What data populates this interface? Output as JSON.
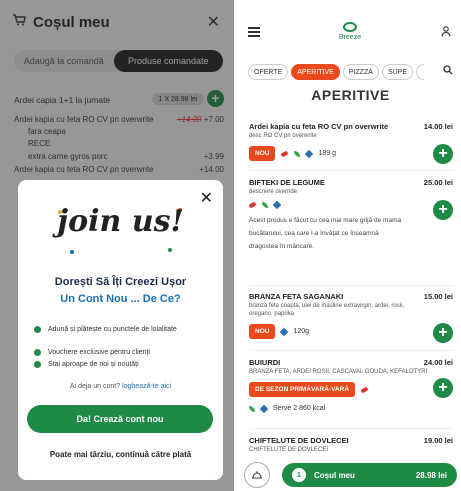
{
  "cart": {
    "title": "Coșul meu",
    "tabs": [
      "Adaugă la comandă",
      "Produse comandate"
    ],
    "active_tab": "Produse comandate",
    "items": [
      {
        "name": "Ardei capia 1+1 la jumate",
        "qty_price": "1 X 28.98 lei"
      },
      {
        "name": "Ardei kapia cu feta RO CV pn overwrite",
        "old_price": "+14.00",
        "price": "+7.00",
        "mods": [
          "fara ceapa",
          "RECE"
        ]
      },
      {
        "name": "extra carne gyros porc",
        "price": "+3.99"
      },
      {
        "name": "Ardei kapia cu feta RO CV pn overwrite",
        "price": "+14.00"
      }
    ]
  },
  "modal": {
    "headline": "join us!",
    "question_line1": "Dorești Să Îți Creezi Ușor",
    "question_line2": "Un Cont Nou ... De Ce?",
    "benefits": [
      "Adună și plătește cu punctele de loialitate",
      "Vouchere exclusive pentru clienți",
      "Stai aproape de noi și noutăți"
    ],
    "account_prompt": "Ai deja un cont?",
    "login_link": "loghează-te aici",
    "create_button": "Da! Crează cont nou",
    "later_link": "Poate mai târziu, continuă către plată"
  },
  "right": {
    "brand": "Breeze",
    "chips": [
      "OFERTE",
      "APERITIVE",
      "PIZZZA",
      "SUPE"
    ],
    "active_chip": "APERITIVE",
    "section_title": "APERITIVE",
    "products": [
      {
        "name": "Ardei kapia cu feta RO CV pn overwrite",
        "price": "14.00 lei",
        "desc": "desc RO CV pn overwrite",
        "tag": "NOU",
        "weight": "189 g"
      },
      {
        "name": "BIFTEKI DE LEGUME",
        "price": "25.00 lei",
        "desc": "descriere override",
        "long": "Acest produs e făcut cu cea mai mare grijă de mama bucătarului, cea care l-a învățat ce înseamnă dragostea în mâncare."
      },
      {
        "name": "BRANZA FETA SAGANAKI",
        "price": "15.00 lei",
        "desc": "branza feta coapta, ulei de masline extravirgin, ardei, rosii, oregano, paprika",
        "tag": "NOU",
        "weight": "120g"
      },
      {
        "name": "BUIURDI",
        "price": "24.00 lei",
        "desc": "BRANZA FETA, ARDEI ROSII, CASCAVAL GOUDA, KEFALOTYRI",
        "tag": "DE SEZON PRIMĂVARĂ-VARĂ",
        "weight": "Serve 2 860 kcal"
      },
      {
        "name": "CHIFTELUTE DE DOVLECEI",
        "price": "19.00 lei",
        "desc": "CHIFTELUTE DE DOVLECEI"
      }
    ],
    "cart_bar": {
      "count": "1",
      "label": "Coșul meu",
      "total": "28.98 lei"
    }
  },
  "colors": {
    "green": "#1e8a45",
    "orange": "#e8491d",
    "blue": "#1a6fb0"
  }
}
